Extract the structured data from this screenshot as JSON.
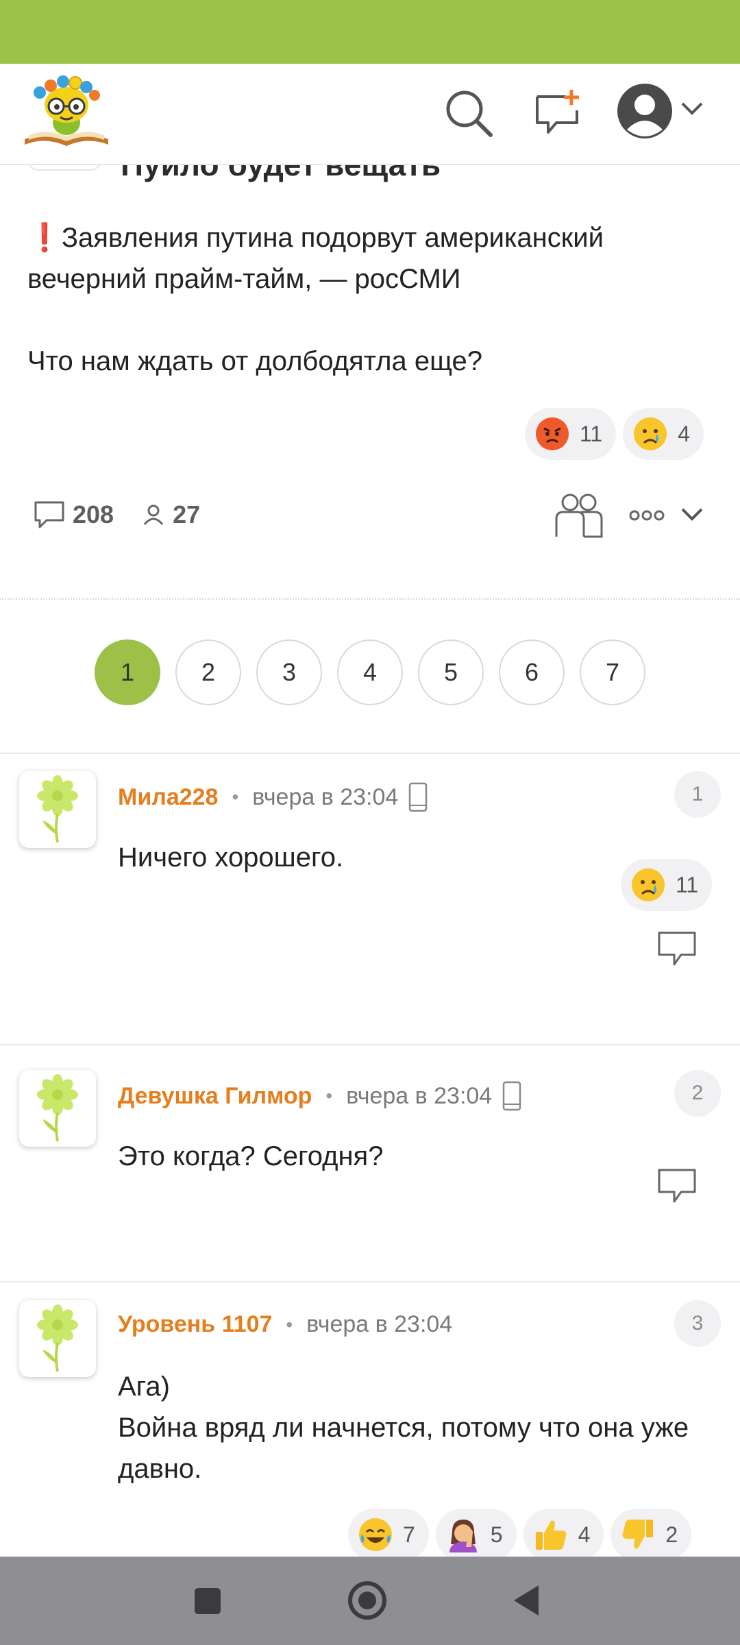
{
  "post": {
    "title": "Пуило будет вещать",
    "line1_mark": "❗",
    "line1": "Заявления путина подорвут американский вечерний прайм-тайм, — росСМИ",
    "line2": "Что нам ждать от долбодятла еще?",
    "reactions": [
      {
        "emoji": "angry-face",
        "count": "11"
      },
      {
        "emoji": "crying-face",
        "count": "4"
      }
    ],
    "comments_count": "208",
    "participants_count": "27"
  },
  "pagination": {
    "pages": [
      "1",
      "2",
      "3",
      "4",
      "5",
      "6",
      "7"
    ],
    "active": "1"
  },
  "comments": [
    {
      "author": "Мила228",
      "separator": "•",
      "time": "вчера в 23:04",
      "mobile": true,
      "number": "1",
      "text": "Ничего хорошего.",
      "reactions": [
        {
          "emoji": "crying-face",
          "count": "11"
        }
      ]
    },
    {
      "author": "Девушка Гилмор",
      "separator": "•",
      "time": "вчера в 23:04",
      "mobile": true,
      "number": "2",
      "text": "Это когда? Сегодня?",
      "reactions": []
    },
    {
      "author": "Уровень 1107",
      "separator": "•",
      "time": "вчера в 23:04",
      "mobile": false,
      "number": "3",
      "text_line1": "Ага)",
      "text_line2": "Война вряд ли начнется, потому что она уже давно.",
      "reactions": [
        {
          "emoji": "laughing-face",
          "count": "7"
        },
        {
          "emoji": "facepalm",
          "count": "5"
        },
        {
          "emoji": "thumbs-up",
          "count": "4"
        },
        {
          "emoji": "thumbs-down",
          "count": "2"
        }
      ]
    }
  ],
  "colors": {
    "accent": "#9cc048",
    "author": "#e57e1d",
    "navbar": "#8f8f93"
  }
}
